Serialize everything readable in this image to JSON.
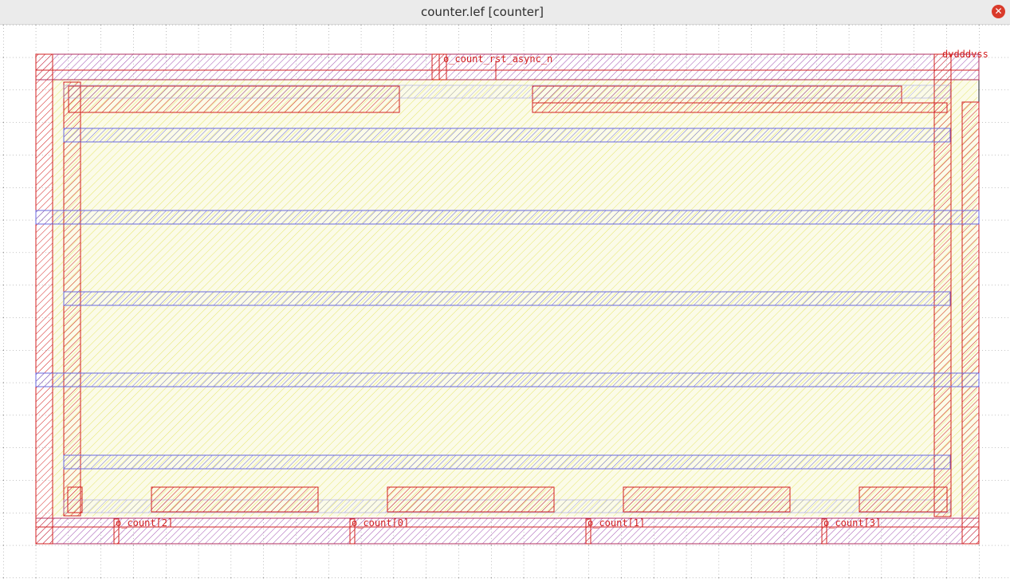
{
  "window": {
    "title": "counter.lef [counter]",
    "close_glyph": "✕"
  },
  "layout": {
    "power_pins": "dvdddvss",
    "top_pin": "o_count_rst_async_n",
    "bottom_pins": [
      "o_count[2]",
      "o_count[0]",
      "o_count[1]",
      "o_count[3]"
    ]
  },
  "colors": {
    "metal_red": "#d32020",
    "metal_blue": "#6a6ae0",
    "fill_yellow": "#e8e860",
    "grid_dot": "#444444"
  }
}
